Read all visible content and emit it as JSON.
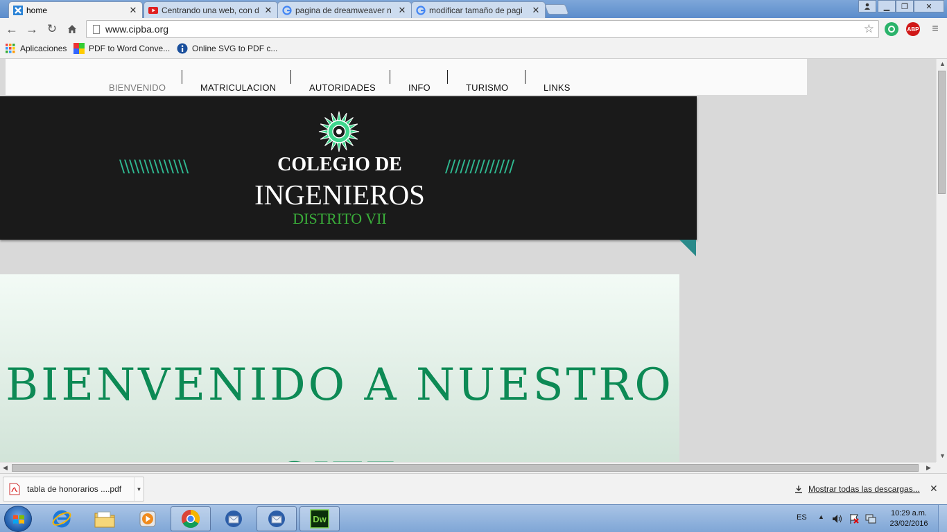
{
  "browser": {
    "tabs": [
      {
        "title": "home",
        "active": true,
        "favicon": "site-favicon"
      },
      {
        "title": "Centrando una web, con d",
        "active": false,
        "favicon": "youtube-favicon"
      },
      {
        "title": "pagina de dreamweaver n",
        "active": false,
        "favicon": "google-favicon"
      },
      {
        "title": "modificar tamaño de pagi",
        "active": false,
        "favicon": "google-favicon"
      }
    ],
    "address": "www.cipba.org",
    "extensions": {
      "abp_label": "ABP"
    },
    "bookmarks": [
      {
        "label": "Aplicaciones",
        "icon": "apps-grid-icon"
      },
      {
        "label": "PDF to Word Conve...",
        "icon": "pdf-to-word-icon"
      },
      {
        "label": "Online SVG to PDF c...",
        "icon": "info-icon"
      }
    ]
  },
  "site": {
    "nav": [
      "BIENVENIDO",
      "MATRICULACION",
      "AUTORIDADES",
      "INFO",
      "TURISMO",
      "LINKS"
    ],
    "header": {
      "line1": "COLEGIO DE",
      "line2": "INGENIEROS",
      "line3": "DISTRITO VII",
      "hatch_left": "\\\\\\\\\\\\\\\\\\\\\\\\\\\\",
      "hatch_right": "//////////////"
    },
    "welcome": "BIENVENIDO A NUESTRO SITE",
    "colors": {
      "accent_green": "#0d8a55",
      "header_bg": "#1a1a1a",
      "distrito_green": "#3aae3a"
    }
  },
  "downloads": {
    "file": "tabla de honorarios ....pdf",
    "show_all": "Mostrar todas las descargas..."
  },
  "taskbar": {
    "language": "ES",
    "time": "10:29 a.m.",
    "date": "23/02/2016"
  }
}
